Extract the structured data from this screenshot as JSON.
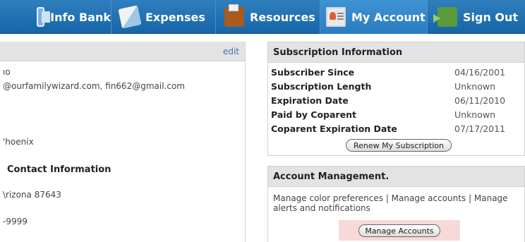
{
  "nav": {
    "items": [
      {
        "label": "Info Bank",
        "icon": "info-bank-icon"
      },
      {
        "label": "Expenses",
        "icon": "expenses-icon"
      },
      {
        "label": "Resources",
        "icon": "resources-icon"
      },
      {
        "label": "My Account",
        "icon": "my-account-icon"
      },
      {
        "label": "Sign Out",
        "icon": "sign-out-icon"
      }
    ],
    "active": "My Account"
  },
  "left_panel": {
    "edit_label": "edit",
    "lines": [
      "ıo",
      "@ourfamilywizard.com, fin662@gmail.com",
      "'hoenix",
      "Contact Information",
      "\\rizona 87643",
      "-9999"
    ]
  },
  "subscription": {
    "title": "Subscription Information",
    "rows": [
      {
        "label": "Subscriber Since",
        "value": "04/16/2001"
      },
      {
        "label": "Subscription Length",
        "value": "Unknown"
      },
      {
        "label": "Expiration Date",
        "value": "06/11/2010"
      },
      {
        "label": "Paid by Coparent",
        "value": "Unknown"
      },
      {
        "label": "Coparent Expiration Date",
        "value": "07/17/2011"
      }
    ],
    "renew_button": "Renew My Subscription"
  },
  "account_management": {
    "title": "Account Management.",
    "description": "Manage color preferences | Manage accounts | Manage alerts and notifications",
    "manage_button": "Manage Accounts"
  },
  "colors": {
    "nav_blue": "#1f70b3",
    "panel_header": "#e3e3e3",
    "link": "#3d78b8",
    "highlight": "#f7d9d9"
  }
}
